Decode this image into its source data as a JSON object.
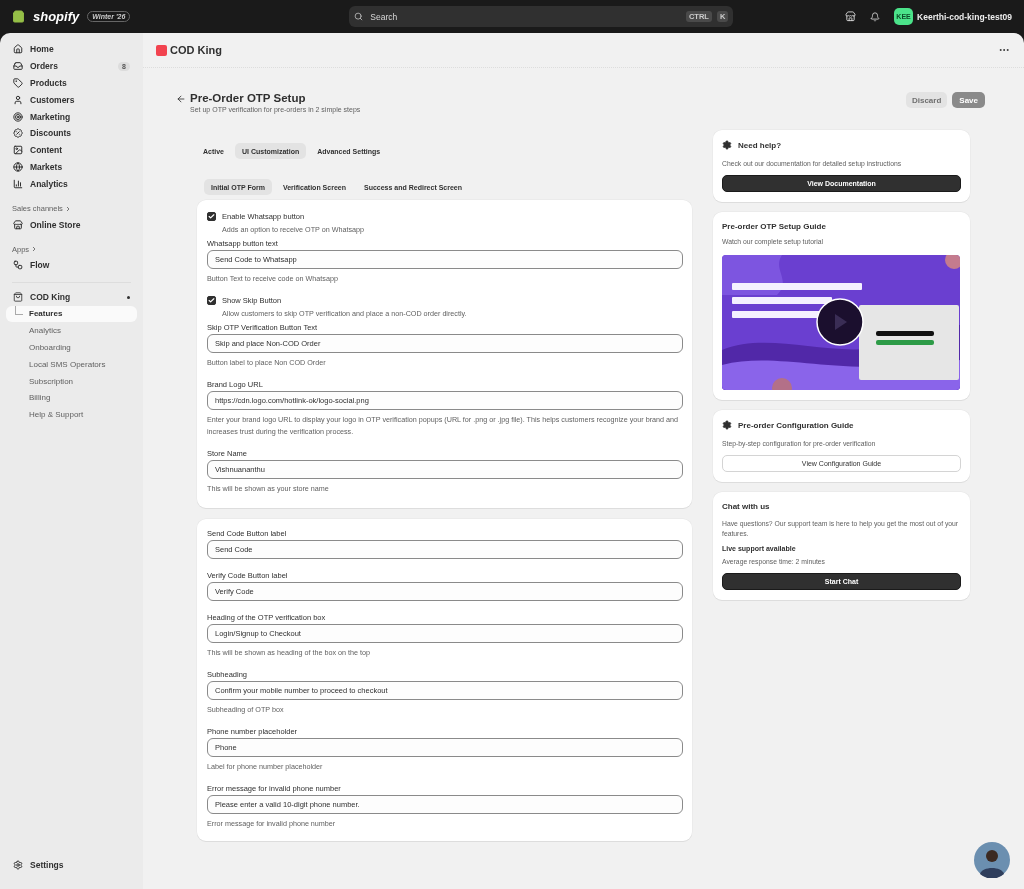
{
  "topbar": {
    "brand": "shopify",
    "edition": "Winter '26",
    "search": {
      "placeholder": "Search"
    },
    "shortcut": [
      "CTRL",
      "K"
    ],
    "account": {
      "initials": "KEE",
      "name": "Keerthi-cod-king-test09"
    }
  },
  "sidebar": {
    "items": [
      {
        "label": "Home"
      },
      {
        "label": "Orders",
        "badge": "8"
      },
      {
        "label": "Products"
      },
      {
        "label": "Customers"
      },
      {
        "label": "Marketing"
      },
      {
        "label": "Discounts"
      },
      {
        "label": "Content"
      },
      {
        "label": "Markets"
      },
      {
        "label": "Analytics"
      }
    ],
    "sections": [
      {
        "title": "Sales channels",
        "items": [
          {
            "label": "Online Store"
          }
        ]
      },
      {
        "title": "Apps",
        "items": [
          {
            "label": "Flow"
          }
        ]
      }
    ],
    "app": {
      "label": "COD King",
      "children": [
        {
          "label": "Features",
          "selected": true
        },
        {
          "label": "Analytics",
          "selected": false
        },
        {
          "label": "Onboarding",
          "selected": false
        },
        {
          "label": "Local SMS Operators",
          "selected": false
        },
        {
          "label": "Subscription",
          "selected": false
        },
        {
          "label": "Billing",
          "selected": false
        },
        {
          "label": "Help & Support",
          "selected": false
        }
      ]
    },
    "footer": {
      "label": "Settings"
    }
  },
  "app_header": {
    "title": "COD King"
  },
  "page": {
    "title": "Pre-Order OTP Setup",
    "subtitle": "Set up OTP verification for pre-orders in 2 simple steps",
    "actions": [
      {
        "label": "Discard",
        "kind": "secondary",
        "disabled": true
      },
      {
        "label": "Save",
        "kind": "primary",
        "disabled": true
      }
    ]
  },
  "tabs": [
    {
      "label": "Active",
      "selected": false
    },
    {
      "label": "UI Customization",
      "selected": true
    },
    {
      "label": "Advanced Settings",
      "selected": false
    }
  ],
  "subtabs": [
    {
      "label": "Initial OTP Form",
      "selected": true
    },
    {
      "label": "Verification Screen",
      "selected": false
    },
    {
      "label": "Success and Redirect Screen",
      "selected": false
    }
  ],
  "form": {
    "sections": [
      {
        "fields": [
          {
            "kind": "checkbox",
            "label": "Enable Whatsapp button",
            "checked": true,
            "help": "Adds an option to receive OTP on Whatsapp"
          },
          {
            "kind": "text",
            "label": "Whatsapp button text",
            "value": "Send Code to Whatsapp",
            "help": "Button Text to receive code on Whatsapp"
          },
          {
            "kind": "checkbox",
            "label": "Show Skip Button",
            "checked": true,
            "help": "Allow customers to skip OTP verification and place a non-COD order directly."
          },
          {
            "kind": "text",
            "label": "Skip OTP Verification Button Text",
            "value": "Skip and place Non-COD Order",
            "help": "Button label to place Non COD Order"
          },
          {
            "kind": "text",
            "label": "Brand Logo URL",
            "value": "https://cdn.logo.com/hotlink-ok/logo-social.png",
            "help": "Enter your brand logo URL to display your logo in OTP verification popups (URL for .png or .jpg file). This helps customers recognize your brand and increases trust during the verification process."
          },
          {
            "kind": "text",
            "label": "Store Name",
            "value": "Vishnuananthu",
            "help": "This will be shown as your store name"
          }
        ]
      },
      {
        "fields": [
          {
            "kind": "text",
            "label": "Send Code Button label",
            "value": "Send Code"
          },
          {
            "kind": "text",
            "label": "Verify Code Button label",
            "value": "Verify Code"
          },
          {
            "kind": "text",
            "label": "Heading of the OTP verification box",
            "value": "Login/Signup to Checkout",
            "help": "This will be shown as heading of the box on the top"
          },
          {
            "kind": "text",
            "label": "Subheading",
            "value": "Confirm your mobile number to proceed to checkout",
            "help": "Subheading of OTP box"
          },
          {
            "kind": "text",
            "label": "Phone number placeholder",
            "value": "Phone",
            "help": "Label for phone number placeholder"
          },
          {
            "kind": "text",
            "label": "Error message for invalid phone number",
            "value": "Please enter a valid 10-digit phone number.",
            "help": "Error message for invalid phone number"
          }
        ]
      }
    ]
  },
  "cards": [
    {
      "kind": "action",
      "title": "Need help?",
      "text": "Check out our documentation for detailed setup instructions",
      "button": {
        "label": "View Documentation",
        "kind": "primary"
      }
    },
    {
      "kind": "video",
      "title": "Pre-order OTP Setup Guide",
      "text": "Watch our complete setup tutorial"
    },
    {
      "kind": "action",
      "title": "Pre-order Configuration Guide",
      "text": "Step-by-step configuration for pre-order verification",
      "button": {
        "label": "View Configuration Guide",
        "kind": "secondary"
      }
    },
    {
      "kind": "chat",
      "title": "Chat with us",
      "text": "Have questions? Our support team is here to help you get the most out of your features.",
      "status": "Live support available",
      "note": "Average response time: 2 minutes",
      "button": {
        "label": "Start Chat",
        "kind": "primary"
      }
    }
  ]
}
